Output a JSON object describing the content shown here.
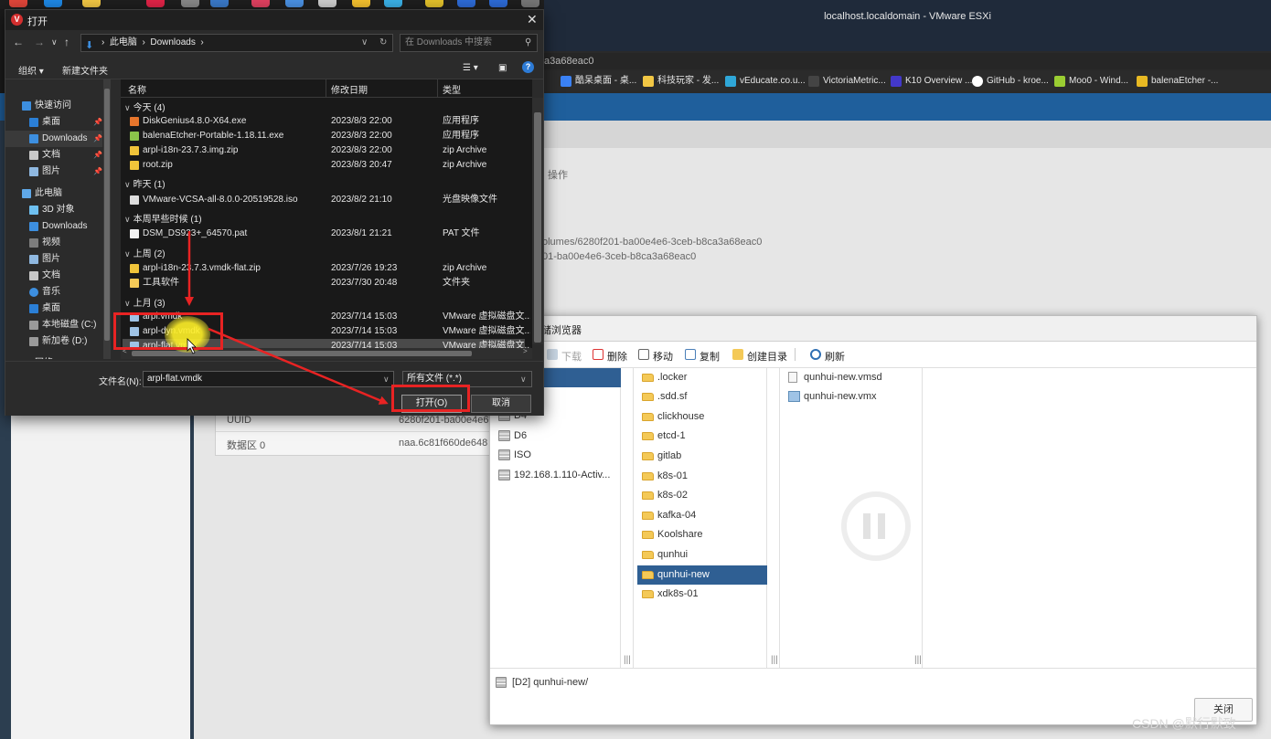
{
  "browser": {
    "title": "localhost.localdomain - VMware ESXi",
    "address_fragment": "a3a68eac0",
    "bookmarks": [
      {
        "label": "酷呆桌面 - 桌...",
        "color": "#3b82f6"
      },
      {
        "label": "科技玩家 - 发...",
        "color": "#f2c744"
      },
      {
        "label": "vEducate.co.u...",
        "color": "#2fa7d8"
      },
      {
        "label": "VictoriaMetric...",
        "color": "#444444"
      },
      {
        "label": "K10 Overview ...",
        "color": "#4338ca"
      },
      {
        "label": "GitHub - kroe...",
        "color": "#ffffff"
      },
      {
        "label": "Moo0 - Wind...",
        "color": "#9acd32"
      },
      {
        "label": "balenaEtcher -...",
        "color": "#e8b923"
      }
    ]
  },
  "esxi": {
    "operation_label": "操作",
    "volume_path": "olumes/6280f201-ba00e4e6-3ceb-b8ca3a68eac0",
    "volume_id": "01-ba00e4e6-3ceb-b8ca3a68eac0",
    "uuid_label": "UUID",
    "uuid_value": "6280f201-ba00e4e6",
    "extent_label": "数据区 0",
    "extent_value": "naa.6c81f660de648"
  },
  "datastore_browser": {
    "title": "储浏览器",
    "toolbar": {
      "download": "下载",
      "delete": "删除",
      "move": "移动",
      "copy": "复制",
      "create_dir": "创建目录",
      "refresh": "刷新"
    },
    "datastores": [
      "D4",
      "D6",
      "ISO",
      "192.168.1.110-Activ..."
    ],
    "folders": [
      "locker",
      ".sdd.sf",
      "clickhouse",
      "etcd-1",
      "gitlab",
      "k8s-01",
      "k8s-02",
      "kafka-04",
      "Koolshare",
      "qunhui",
      "qunhui-new",
      "xdk8s-01"
    ],
    "folders_first": ".locker",
    "selected_folder": "qunhui-new",
    "files": [
      "qunhui-new.vmsd",
      "qunhui-new.vmx"
    ],
    "path": "[D2] qunhui-new/",
    "close_label": "关闭"
  },
  "open_dialog": {
    "title": "打开",
    "breadcrumb": [
      "此电脑",
      "Downloads"
    ],
    "search_placeholder": "在 Downloads 中搜索",
    "organize_label": "组织 ▾",
    "new_folder_label": "新建文件夹",
    "nav": {
      "quick_access": "快速访问",
      "desktop": "桌面",
      "downloads": "Downloads",
      "documents": "文档",
      "pictures": "图片",
      "this_pc": "此电脑",
      "objects3d": "3D 对象",
      "downloads2": "Downloads",
      "videos": "视频",
      "pictures2": "图片",
      "documents2": "文档",
      "music": "音乐",
      "desktop2": "桌面",
      "local_disk": "本地磁盘 (C:)",
      "new_volume": "新加卷 (D:)",
      "network": "网络"
    },
    "columns": {
      "name": "名称",
      "date": "修改日期",
      "type": "类型"
    },
    "groups": {
      "today": "今天 (4)",
      "yesterday": "昨天 (1)",
      "earlier_week": "本周早些时候 (1)",
      "last_week": "上周 (2)",
      "last_month": "上月 (3)"
    },
    "files": {
      "today": [
        {
          "name": "DiskGenius4.8.0-X64.exe",
          "date": "2023/8/3 22:00",
          "type": "应用程序",
          "icon": "#e8762c"
        },
        {
          "name": "balenaEtcher-Portable-1.18.11.exe",
          "date": "2023/8/3 22:00",
          "type": "应用程序",
          "icon": "#8bc34a"
        },
        {
          "name": "arpl-i18n-23.7.3.img.zip",
          "date": "2023/8/3 22:00",
          "type": "zip Archive",
          "icon": "#f0c43a"
        },
        {
          "name": "root.zip",
          "date": "2023/8/3 20:47",
          "type": "zip Archive",
          "icon": "#f0c43a"
        }
      ],
      "yesterday": [
        {
          "name": "VMware-VCSA-all-8.0.0-20519528.iso",
          "date": "2023/8/2 21:10",
          "type": "光盘映像文件",
          "icon": "#dddddd"
        }
      ],
      "earlier_week": [
        {
          "name": "DSM_DS923+_64570.pat",
          "date": "2023/8/1 21:21",
          "type": "PAT 文件",
          "icon": "#f2f2f2"
        }
      ],
      "last_week": [
        {
          "name": "arpl-i18n-23.7.3.vmdk-flat.zip",
          "date": "2023/7/26 19:23",
          "type": "zip Archive",
          "icon": "#f0c43a"
        },
        {
          "name": "工具软件",
          "date": "2023/7/30 20:48",
          "type": "文件夹",
          "icon": "#f4c957"
        }
      ],
      "last_month": [
        {
          "name": "arpl.vmdk",
          "date": "2023/7/14 15:03",
          "type": "VMware 虚拟磁盘文...",
          "icon": "#9fc3e6"
        },
        {
          "name": "arpl-dyn.vmdk",
          "date": "2023/7/14 15:03",
          "type": "VMware 虚拟磁盘文...",
          "icon": "#9fc3e6"
        },
        {
          "name": "arpl-flat.vmdk",
          "date": "2023/7/14 15:03",
          "type": "VMware 虚拟磁盘文...",
          "icon": "#9fc3e6"
        }
      ]
    },
    "filename_label": "文件名(N):",
    "filename_value": "arpl-flat.vmdk",
    "filter_value": "所有文件 (*.*)",
    "open_label": "打开(O)",
    "cancel_label": "取消"
  },
  "watermark": "CSDN @默行默致"
}
